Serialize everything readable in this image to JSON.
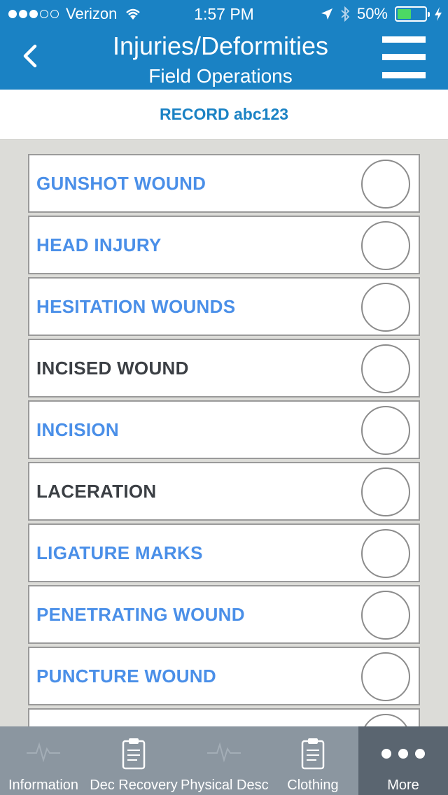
{
  "status_bar": {
    "carrier": "Verizon",
    "time": "1:57 PM",
    "battery": "50%"
  },
  "nav": {
    "title": "Injuries/Deformities",
    "subtitle": "Field Operations"
  },
  "record": {
    "label": "RECORD abc123"
  },
  "items": [
    {
      "label": "GUNSHOT WOUND",
      "color": "#4a8fe8"
    },
    {
      "label": "HEAD INJURY",
      "color": "#4a8fe8"
    },
    {
      "label": "HESITATION WOUNDS",
      "color": "#4a8fe8"
    },
    {
      "label": "INCISED WOUND",
      "color": "#3b3f44"
    },
    {
      "label": "INCISION",
      "color": "#4a8fe8"
    },
    {
      "label": "LACERATION",
      "color": "#3b3f44"
    },
    {
      "label": "LIGATURE MARKS",
      "color": "#4a8fe8"
    },
    {
      "label": "PENETRATING WOUND",
      "color": "#4a8fe8"
    },
    {
      "label": "PUNCTURE WOUND",
      "color": "#4a8fe8"
    },
    {
      "label": "",
      "color": "#4a8fe8"
    }
  ],
  "tabs": [
    {
      "label": "Information",
      "icon": "pulse-icon"
    },
    {
      "label": "Dec Recovery",
      "icon": "clipboard-icon"
    },
    {
      "label": "Physical Desc",
      "icon": "pulse-icon"
    },
    {
      "label": "Clothing",
      "icon": "clipboard-icon"
    },
    {
      "label": "More",
      "icon": "more-icon"
    }
  ],
  "colors": {
    "nav_bar": "#1a82c4",
    "tab_bar": "#8b96a0",
    "tab_active": "#5a6570"
  }
}
